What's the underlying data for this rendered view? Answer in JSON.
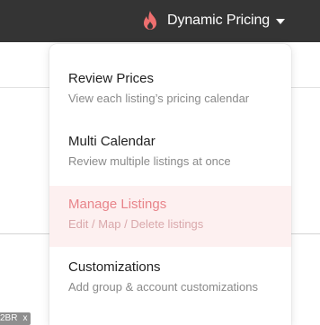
{
  "navbar": {
    "brand_icon": "flame-icon",
    "brand_label": "Dynamic Pricing",
    "caret_icon": "caret-down-icon",
    "colors": {
      "background": "#343434",
      "flame": "#ee6f6f"
    }
  },
  "background": {
    "tag_label": "2BR",
    "tag_close": "x"
  },
  "dropdown": {
    "items": [
      {
        "title": "Review Prices",
        "description": "View each listing’s pricing calendar",
        "active": false
      },
      {
        "title": "Multi Calendar",
        "description": "Review multiple listings at once",
        "active": false
      },
      {
        "title": "Manage Listings",
        "description": "Edit / Map / Delete listings",
        "active": true
      },
      {
        "title": "Customizations",
        "description": "Add group & account customizations",
        "active": false
      }
    ],
    "colors": {
      "active_background": "#fdf0f0",
      "active_text": "#e8848a"
    }
  }
}
